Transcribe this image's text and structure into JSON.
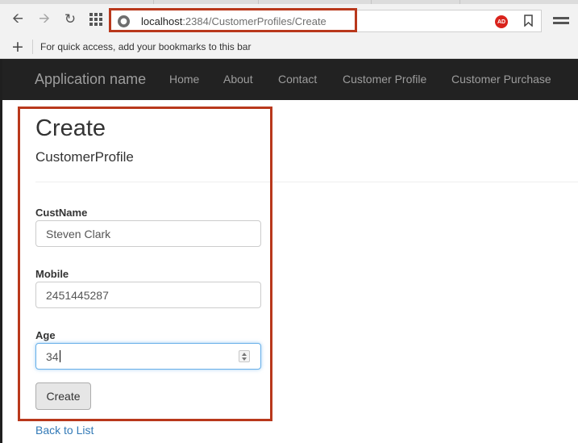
{
  "browser": {
    "url_host": "localhost",
    "url_path": ":2384/CustomerProfiles/Create",
    "icons": [
      "back-icon",
      "forward-icon",
      "reload-icon",
      "apps-icon",
      "site-info-icon",
      "adblock-icon",
      "bookmark-icon",
      "menu-icon"
    ],
    "adblock_label": "AD",
    "bookmarks_bar_text": "For quick access, add your bookmarks to this bar",
    "bookmarks_add": "+"
  },
  "nav": {
    "brand": "Application name",
    "links": [
      "Home",
      "About",
      "Contact",
      "Customer Profile",
      "Customer Purchase"
    ]
  },
  "page": {
    "title": "Create",
    "subtitle": "CustomerProfile",
    "fields": [
      {
        "label": "CustName",
        "value": "Steven Clark"
      },
      {
        "label": "Mobile",
        "value": "2451445287"
      },
      {
        "label": "Age",
        "value": "34"
      }
    ],
    "submit_label": "Create",
    "back_link": "Back to List"
  },
  "colors": {
    "annotation": "#b9381c",
    "navbar": "#222222",
    "link": "#337ab7"
  }
}
